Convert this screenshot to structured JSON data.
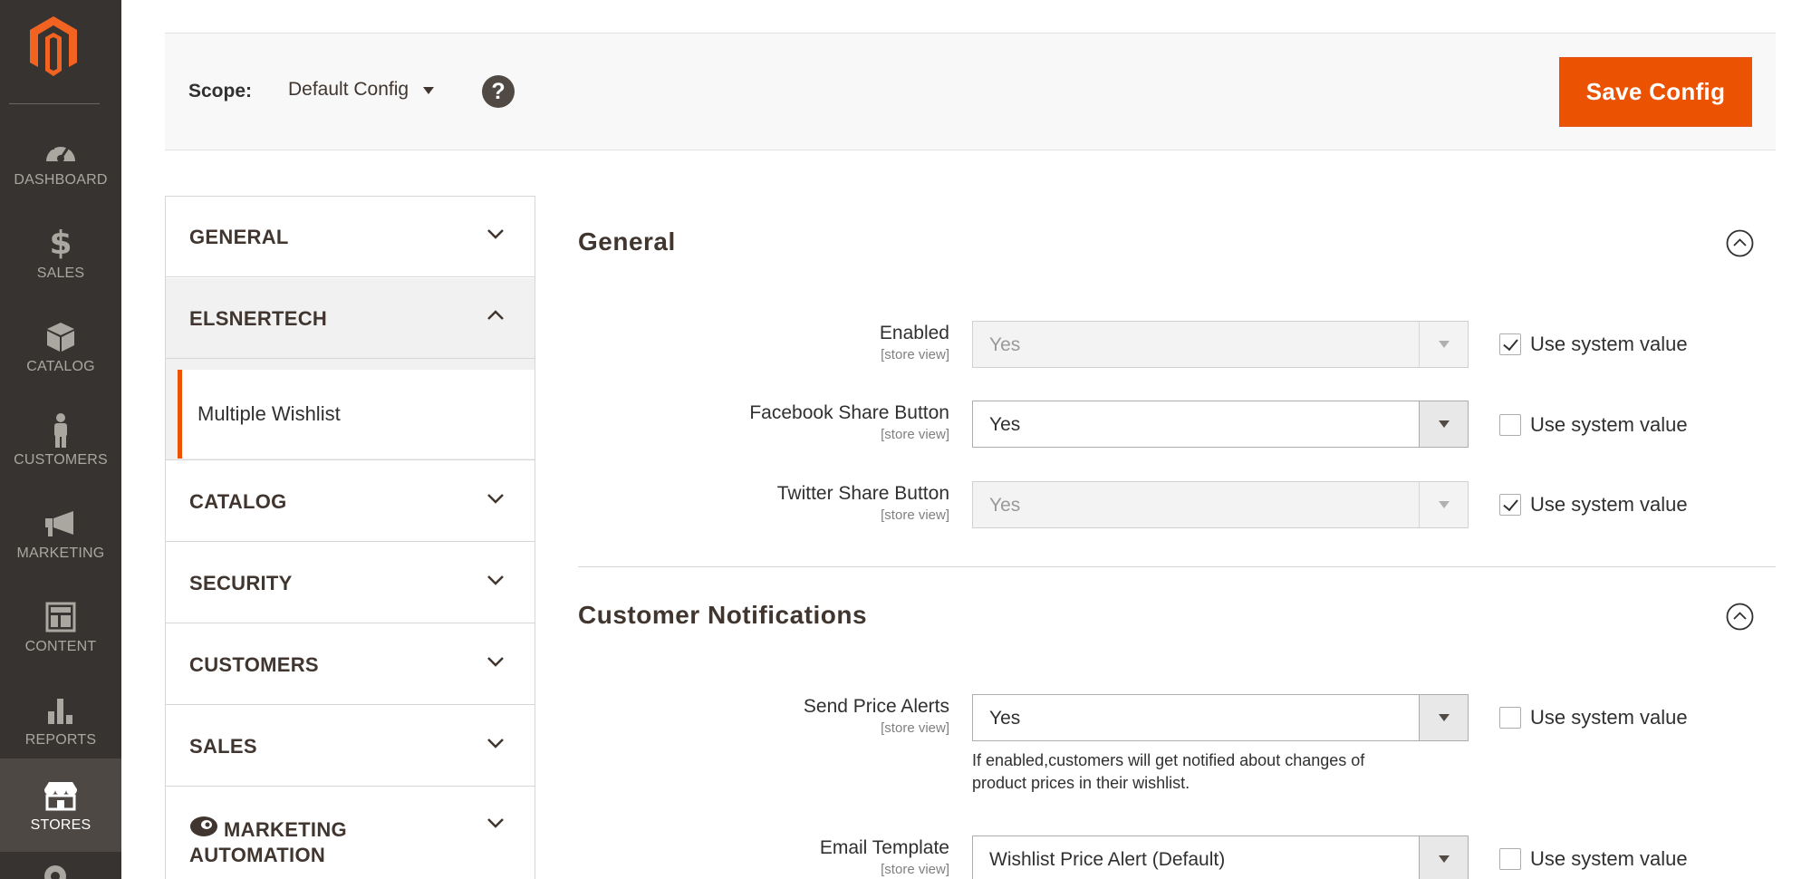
{
  "colors": {
    "brand_orange": "#eb5202",
    "menu_bg": "#373330",
    "menu_active_bg": "#4d4844"
  },
  "admin_menu": {
    "logo": "magento-logo-icon",
    "items": [
      {
        "label": "DASHBOARD",
        "icon": "dashboard-icon"
      },
      {
        "label": "SALES",
        "icon": "dollar-icon"
      },
      {
        "label": "CATALOG",
        "icon": "box-icon"
      },
      {
        "label": "CUSTOMERS",
        "icon": "person-icon"
      },
      {
        "label": "MARKETING",
        "icon": "megaphone-icon"
      },
      {
        "label": "CONTENT",
        "icon": "layout-icon"
      },
      {
        "label": "REPORTS",
        "icon": "bar-chart-icon"
      },
      {
        "label": "STORES",
        "icon": "storefront-icon",
        "active": true
      }
    ]
  },
  "header": {
    "scope_label": "Scope:",
    "scope_value": "Default Config",
    "help_icon": "?",
    "save_label": "Save Config"
  },
  "config_nav": {
    "sections": [
      {
        "label": "GENERAL",
        "expanded": false
      },
      {
        "label": "ELSNERTECH",
        "expanded": true,
        "children": [
          {
            "label": "Multiple Wishlist",
            "active": true
          }
        ]
      },
      {
        "label": "CATALOG",
        "expanded": false
      },
      {
        "label": "SECURITY",
        "expanded": false
      },
      {
        "label": "CUSTOMERS",
        "expanded": false
      },
      {
        "label": "SALES",
        "expanded": false
      },
      {
        "label": "MARKETING AUTOMATION",
        "expanded": false,
        "icon": "marketing-automation-icon"
      }
    ]
  },
  "form": {
    "use_system_value_label": "Use system value",
    "scope_hint": "[store view]",
    "groups": [
      {
        "title": "General",
        "fields": [
          {
            "label": "Enabled",
            "value": "Yes",
            "disabled": true,
            "use_system_value": true
          },
          {
            "label": "Facebook Share Button",
            "value": "Yes",
            "disabled": false,
            "use_system_value": false
          },
          {
            "label": "Twitter Share Button",
            "value": "Yes",
            "disabled": true,
            "use_system_value": true
          }
        ]
      },
      {
        "title": "Customer Notifications",
        "fields": [
          {
            "label": "Send Price Alerts",
            "value": "Yes",
            "disabled": false,
            "use_system_value": false,
            "note_line1": "If enabled,customers will get notified about changes of",
            "note_line2": "product prices in their wishlist."
          },
          {
            "label": "Email Template",
            "value": "Wishlist Price Alert (Default)",
            "disabled": false,
            "use_system_value": false
          }
        ]
      }
    ]
  }
}
